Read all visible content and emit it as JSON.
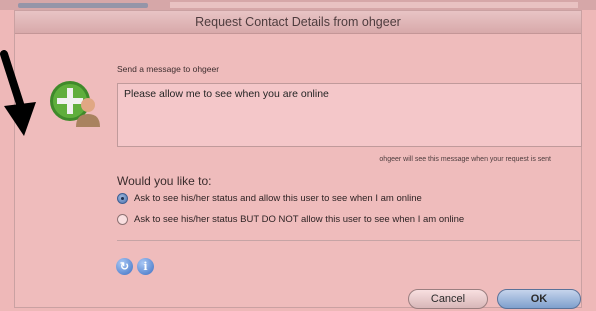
{
  "window": {
    "title": "Request Contact Details from ohgeer"
  },
  "message": {
    "label": "Send a message to ohgeer",
    "value": "Please allow me to see when you are online",
    "note": "ohgeer will see this message when your request is sent"
  },
  "choice": {
    "question": "Would you like to:",
    "options": [
      {
        "label": "Ask to see his/her status and allow this user to see when I am online",
        "selected": true
      },
      {
        "label": "Ask to see his/her status BUT DO NOT allow this user to see when I am online",
        "selected": false
      }
    ]
  },
  "buttons": {
    "cancel": "Cancel",
    "ok": "OK"
  },
  "icons": {
    "contact": "add-contact-icon",
    "help": "help-icon",
    "info": "info-icon"
  },
  "colors": {
    "window_bg": "#efbcbc",
    "ok_button": "#7fa0cd",
    "radio_selected": "#4d74b0"
  }
}
